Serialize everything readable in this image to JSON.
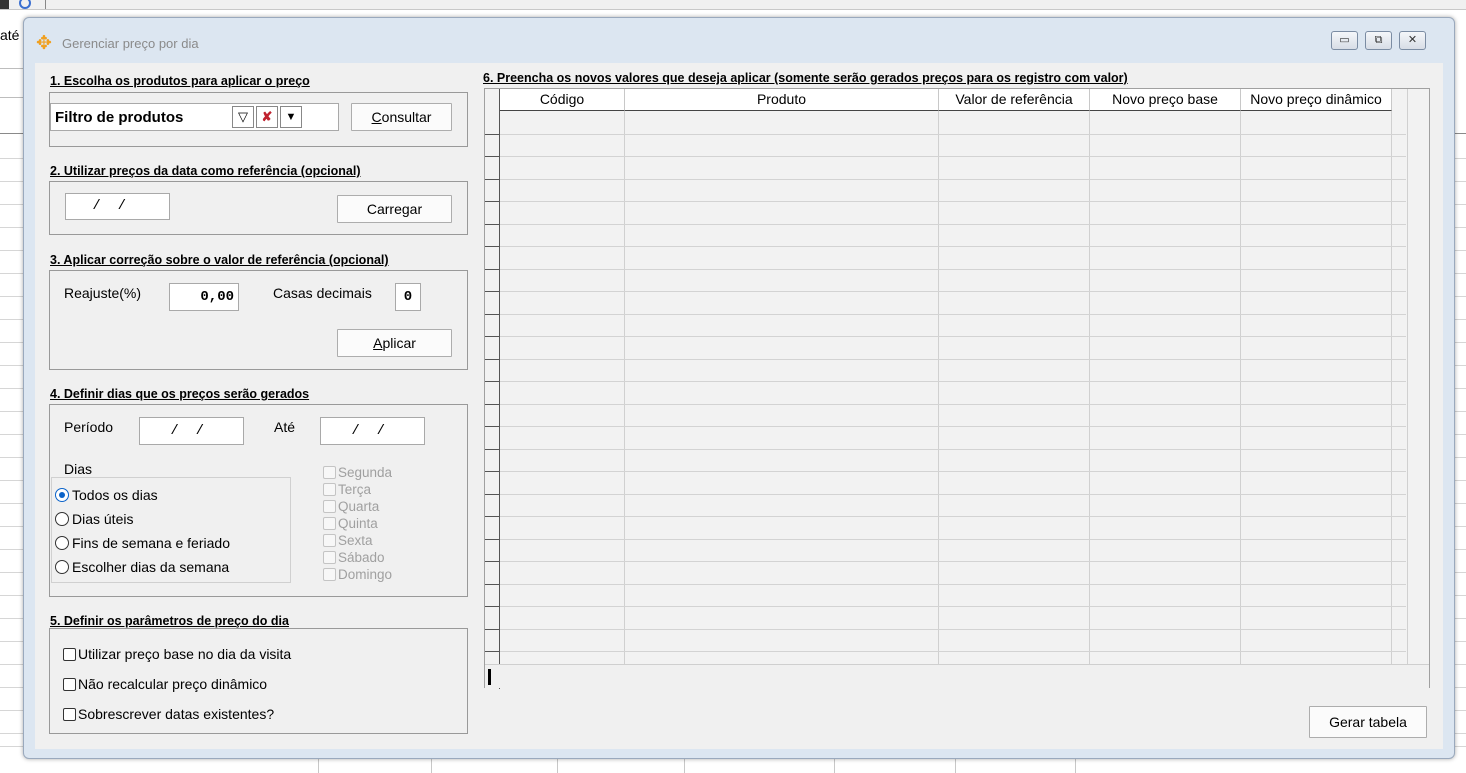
{
  "background": {
    "ate_label": "até"
  },
  "window": {
    "title": "Gerenciar preço por dia",
    "minimize_glyph": "▭",
    "restore_glyph": "⧉",
    "close_glyph": "✕"
  },
  "section1": {
    "title": "1. Escolha os produtos para aplicar o preço",
    "filter_label": "Filtro de produtos",
    "consultar_underline": "C",
    "consultar_rest": "onsultar"
  },
  "section2": {
    "title": "2. Utilizar preços da data como referência (opcional)",
    "date_value": " /  /",
    "carregar_label": "Carregar"
  },
  "section3": {
    "title": "3. Aplicar correção sobre o valor de referência (opcional)",
    "reajuste_label": "Reajuste(%)",
    "reajuste_value": "0,00",
    "casas_label": "Casas decimais",
    "casas_value": "0",
    "aplicar_underline": "A",
    "aplicar_rest": "plicar"
  },
  "section4": {
    "title": "4. Definir dias que os preços serão gerados",
    "periodo_label": "Período",
    "periodo_value": " /  /",
    "ate_label": "Até",
    "ate_value": " /  /",
    "dias_label": "Dias",
    "radio_options": [
      {
        "label": "Todos os dias",
        "selected": true
      },
      {
        "label": "Dias úteis",
        "selected": false
      },
      {
        "label": "Fins de semana e feriado",
        "selected": false
      },
      {
        "label": "Escolher dias da semana",
        "selected": false
      }
    ],
    "weekdays": [
      "Segunda",
      "Terça",
      "Quarta",
      "Quinta",
      "Sexta",
      "Sábado",
      "Domingo"
    ]
  },
  "section5": {
    "title": "5. Definir os parâmetros de preço do dia",
    "options": [
      {
        "label": "Utilizar preço base no dia da visita",
        "checked": false
      },
      {
        "label": "Não recalcular preço dinâmico",
        "checked": false
      },
      {
        "label": "Sobrescrever datas existentes?",
        "checked": false
      }
    ]
  },
  "section6": {
    "title": "6. Preencha os novos valores que deseja aplicar (somente serão gerados preços para os registro com valor)",
    "columns": [
      "Código",
      "Produto",
      "Valor de referência",
      "Novo preço base",
      "Novo preço dinâmico"
    ],
    "rows": []
  },
  "gerar_label": "Gerar tabela"
}
